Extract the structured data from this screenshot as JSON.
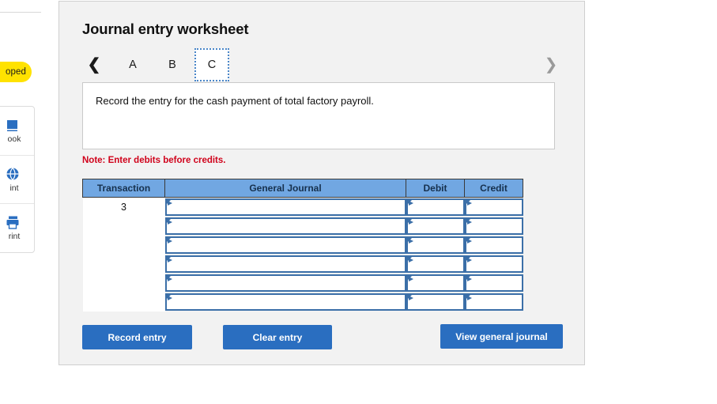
{
  "sidebar": {
    "status_badge": "oped",
    "items": [
      {
        "label": "ook",
        "icon": "book-icon"
      },
      {
        "label": "int",
        "icon": "hint-globe-icon"
      },
      {
        "label": "rint",
        "icon": "print-icon"
      }
    ]
  },
  "card": {
    "title": "Journal entry worksheet",
    "tabs": {
      "prev_icon": "chevron-left-icon",
      "next_icon": "chevron-right-icon",
      "items": [
        {
          "label": "A",
          "active": false
        },
        {
          "label": "B",
          "active": false
        },
        {
          "label": "C",
          "active": true
        }
      ]
    },
    "prompt": "Record the entry for the cash payment of total factory payroll.",
    "note": "Note: Enter debits before credits.",
    "table": {
      "headers": [
        "Transaction",
        "General Journal",
        "Debit",
        "Credit"
      ],
      "rows": [
        {
          "transaction": "3",
          "general_journal": "",
          "debit": "",
          "credit": ""
        },
        {
          "transaction": "",
          "general_journal": "",
          "debit": "",
          "credit": ""
        },
        {
          "transaction": "",
          "general_journal": "",
          "debit": "",
          "credit": ""
        },
        {
          "transaction": "",
          "general_journal": "",
          "debit": "",
          "credit": ""
        },
        {
          "transaction": "",
          "general_journal": "",
          "debit": "",
          "credit": ""
        },
        {
          "transaction": "",
          "general_journal": "",
          "debit": "",
          "credit": ""
        }
      ]
    },
    "buttons": {
      "record": "Record entry",
      "clear": "Clear entry",
      "view": "View general journal"
    }
  },
  "colors": {
    "header_blue": "#71a7e2",
    "button_blue": "#2a6ec0",
    "input_border_blue": "#3b6fa8",
    "note_red": "#d0021b",
    "badge_yellow": "#ffe200",
    "card_bg": "#f2f2f2"
  }
}
